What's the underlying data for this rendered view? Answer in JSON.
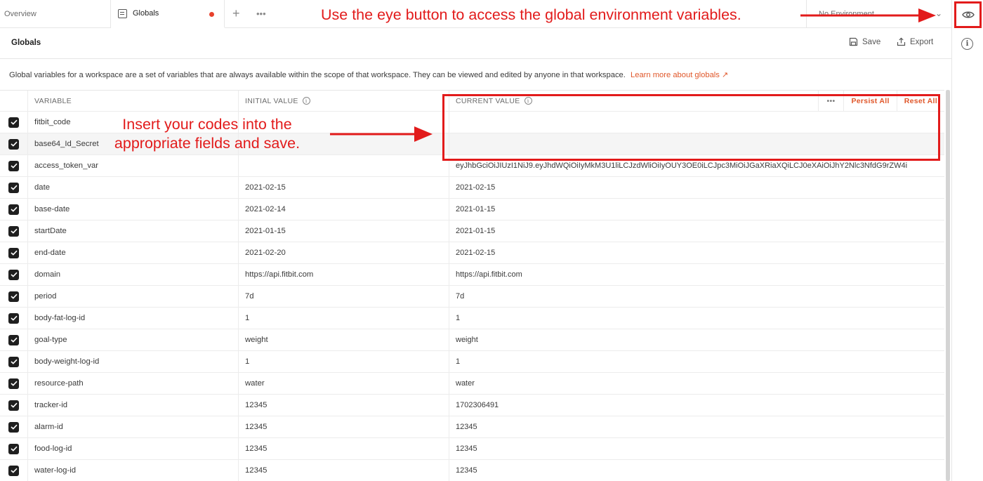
{
  "tabs": {
    "overview": "Overview",
    "globals": "Globals",
    "more": "•••"
  },
  "environment": {
    "selected": "No Environment"
  },
  "section": {
    "title": "Globals",
    "save_label": "Save",
    "export_label": "Export",
    "description": "Global variables for a workspace are a set of variables that are always available within the scope of that workspace. They can be viewed and edited by anyone in that workspace.",
    "learn_more": "Learn more about globals ↗"
  },
  "table": {
    "headers": {
      "variable": "VARIABLE",
      "initial": "INITIAL VALUE",
      "current": "CURRENT VALUE",
      "persist_all": "Persist All",
      "reset_all": "Reset All",
      "more": "•••"
    },
    "rows": [
      {
        "variable": "fitbit_code",
        "initial": "",
        "current": ""
      },
      {
        "variable": "base64_Id_Secret",
        "initial": "",
        "current": ""
      },
      {
        "variable": "access_token_var",
        "initial": "",
        "current": "eyJhbGciOiJIUzI1NiJ9.eyJhdWQiOiIyMkM3U1liLCJzdWliOiIyOUY3OE0iLCJpc3MiOiJGaXRiaXQiLCJ0eXAiOiJhY2Nlc3NfdG9rZW4i"
      },
      {
        "variable": "date",
        "initial": "2021-02-15",
        "current": "2021-02-15"
      },
      {
        "variable": "base-date",
        "initial": "2021-02-14",
        "current": "2021-01-15"
      },
      {
        "variable": "startDate",
        "initial": "2021-01-15",
        "current": "2021-01-15"
      },
      {
        "variable": "end-date",
        "initial": "2021-02-20",
        "current": "2021-02-15"
      },
      {
        "variable": "domain",
        "initial": "https://api.fitbit.com",
        "current": "https://api.fitbit.com"
      },
      {
        "variable": "period",
        "initial": "7d",
        "current": "7d"
      },
      {
        "variable": "body-fat-log-id",
        "initial": "1",
        "current": "1"
      },
      {
        "variable": "goal-type",
        "initial": "weight",
        "current": "weight"
      },
      {
        "variable": "body-weight-log-id",
        "initial": "1",
        "current": "1"
      },
      {
        "variable": "resource-path",
        "initial": "water",
        "current": "water"
      },
      {
        "variable": "tracker-id",
        "initial": "12345",
        "current": "1702306491"
      },
      {
        "variable": "alarm-id",
        "initial": "12345",
        "current": "12345"
      },
      {
        "variable": "food-log-id",
        "initial": "12345",
        "current": "12345"
      },
      {
        "variable": "water-log-id",
        "initial": "12345",
        "current": "12345"
      }
    ]
  },
  "annotations": {
    "top": "Use the eye button to access the global environment variables.",
    "side": "Insert your codes into the appropriate fields and save."
  },
  "colors": {
    "annotation": "#e21b1b",
    "accent": "#e0572a",
    "checkbox": "#1f1f1f"
  }
}
